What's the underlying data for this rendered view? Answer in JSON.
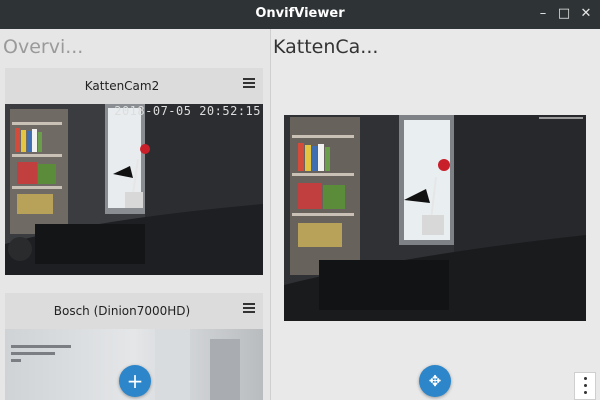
{
  "window": {
    "title": "OnvifViewer",
    "minimize_glyph": "–",
    "maximize_glyph": "□",
    "close_glyph": "✕"
  },
  "overview": {
    "title": "Overvi..."
  },
  "cameras": [
    {
      "name": "KattenCam2",
      "timestamp": "2018-07-05 20:52:15"
    },
    {
      "name": "Bosch (Dinion7000HD)"
    }
  ],
  "detail": {
    "title": "KattenCa..."
  },
  "fab": {
    "add_glyph": "+",
    "ptz_glyph": "✥"
  },
  "colors": {
    "titlebar": "#2e3436",
    "accent": "#2d86c9",
    "background": "#e9e9e9"
  }
}
